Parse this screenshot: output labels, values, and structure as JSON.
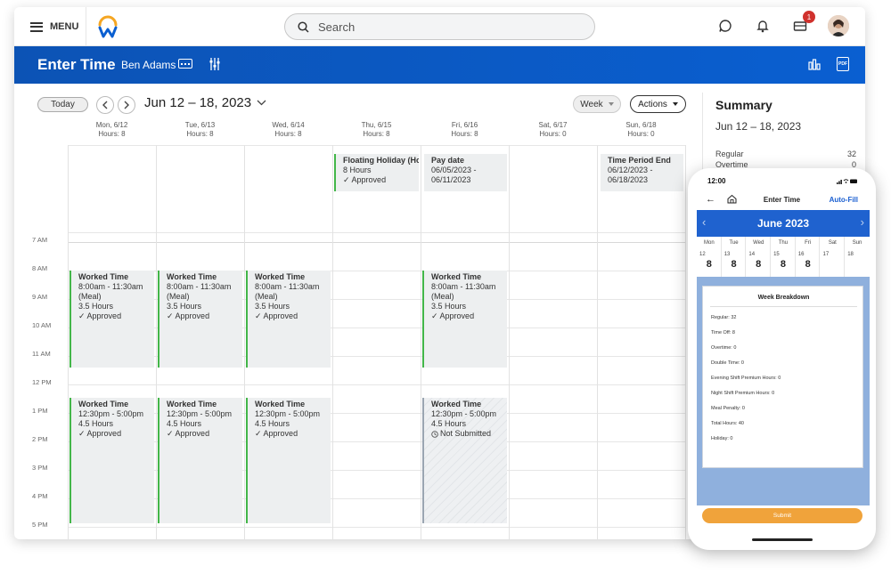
{
  "topnav": {
    "menu_label": "MENU",
    "search_placeholder": "Search",
    "notification_count": "1"
  },
  "header": {
    "title": "Enter Time",
    "worker": "Ben Adams",
    "pdf_label": "PDF"
  },
  "toolbar": {
    "today_label": "Today",
    "date_range": "Jun 12 – 18, 2023",
    "view_label": "Week",
    "actions_label": "Actions"
  },
  "days": [
    {
      "label": "Mon, 6/12",
      "hours": "Hours: 8"
    },
    {
      "label": "Tue, 6/13",
      "hours": "Hours: 8"
    },
    {
      "label": "Wed, 6/14",
      "hours": "Hours: 8"
    },
    {
      "label": "Thu, 6/15",
      "hours": "Hours: 8"
    },
    {
      "label": "Fri, 6/16",
      "hours": "Hours: 8"
    },
    {
      "label": "Sat, 6/17",
      "hours": "Hours: 0"
    },
    {
      "label": "Sun, 6/18",
      "hours": "Hours: 0"
    }
  ],
  "time_labels": [
    "7 AM",
    "8 AM",
    "9 AM",
    "10 AM",
    "11 AM",
    "12 PM",
    "1 PM",
    "2 PM",
    "3 PM",
    "4 PM",
    "5 PM"
  ],
  "allday": {
    "floating": {
      "title": "Floating Holiday (Hour",
      "line1": "8 Hours",
      "status": "✓ Approved"
    },
    "paydate": {
      "title": "Pay date",
      "line1": "06/05/2023 -",
      "line2": "06/11/2023"
    },
    "period_end": {
      "title": "Time Period End",
      "line1": "06/12/2023 -",
      "line2": "06/18/2023"
    }
  },
  "morning": {
    "title": "Worked Time",
    "time": "8:00am - 11:30am",
    "note": "(Meal)",
    "hours": "3.5 Hours",
    "status": "✓ Approved"
  },
  "afternoon": {
    "title": "Worked Time",
    "time": "12:30pm - 5:00pm",
    "hours": "4.5 Hours",
    "status": "✓ Approved",
    "status_pending": "Not Submitted"
  },
  "summary": {
    "title": "Summary",
    "range": "Jun 12 – 18, 2023",
    "regular_label": "Regular",
    "regular_value": "32",
    "overtime_label": "Overtime",
    "overtime_value": "0"
  },
  "phone": {
    "time": "12:00",
    "title": "Enter Time",
    "autofill": "Auto-Fill",
    "month": "June 2023",
    "week": [
      {
        "name": "Mon",
        "num": "12",
        "hrs": "8"
      },
      {
        "name": "Tue",
        "num": "13",
        "hrs": "8"
      },
      {
        "name": "Wed",
        "num": "14",
        "hrs": "8"
      },
      {
        "name": "Thu",
        "num": "15",
        "hrs": "8"
      },
      {
        "name": "Fri",
        "num": "16",
        "hrs": "8"
      },
      {
        "name": "Sat",
        "num": "17",
        "hrs": ""
      },
      {
        "name": "Sun",
        "num": "18",
        "hrs": ""
      }
    ],
    "breakdown_title": "Week Breakdown",
    "stats": [
      "Regular: 32",
      "Time Off: 8",
      "Overtime: 0",
      "Double Time: 0",
      "Evening Shift Premium Hours: 0",
      "Night Shift Premium Hours: 0",
      "Meal Penalty: 0",
      "Total Hours: 40",
      "Holiday: 0"
    ],
    "submit": "Submit"
  },
  "colors": {
    "brand_blue": "#0a5fd1",
    "approved_green": "#43b649",
    "submit_orange": "#f0a33b"
  }
}
